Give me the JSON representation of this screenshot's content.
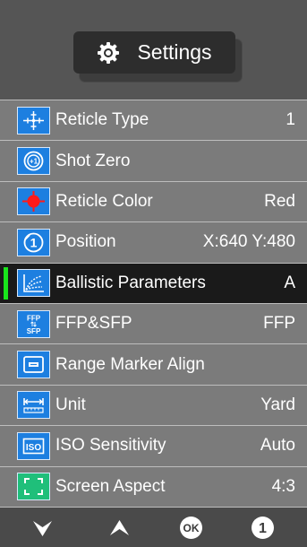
{
  "header": {
    "title": "Settings",
    "icon": "gear-icon"
  },
  "menu": [
    {
      "label": "Reticle Type",
      "value": "1",
      "icon": "reticle-type-icon"
    },
    {
      "label": "Shot Zero",
      "value": "",
      "icon": "shot-zero-icon"
    },
    {
      "label": "Reticle Color",
      "value": "Red",
      "icon": "reticle-color-icon"
    },
    {
      "label": "Position",
      "value": "X:640 Y:480",
      "icon": "position-icon"
    },
    {
      "label": "Ballistic Parameters",
      "value": "A",
      "icon": "ballistic-parameters-icon",
      "selected": true
    },
    {
      "label": "FFP&SFP",
      "value": "FFP",
      "icon": "ffp-sfp-icon",
      "icon_text": [
        "FFP",
        "SFP"
      ]
    },
    {
      "label": "Range Marker Align",
      "value": "",
      "icon": "range-marker-icon"
    },
    {
      "label": "Unit",
      "value": "Yard",
      "icon": "unit-icon"
    },
    {
      "label": "ISO Sensitivity",
      "value": "Auto",
      "icon": "iso-icon",
      "icon_text": [
        "ISO"
      ]
    },
    {
      "label": "Screen Aspect",
      "value": "4:3",
      "icon": "screen-aspect-icon"
    }
  ],
  "footer": {
    "buttons": [
      {
        "name": "down-button",
        "icon": "chevron-down-icon"
      },
      {
        "name": "up-button",
        "icon": "chevron-up-icon"
      },
      {
        "name": "ok-button",
        "icon": "ok-icon",
        "label": "OK"
      },
      {
        "name": "one-button",
        "icon": "number-one-icon",
        "label": "1"
      }
    ]
  },
  "colors": {
    "icon_bg": "#1d7fe0",
    "selected_indicator": "#19e51c",
    "reticle_red": "#ff1a1a"
  }
}
